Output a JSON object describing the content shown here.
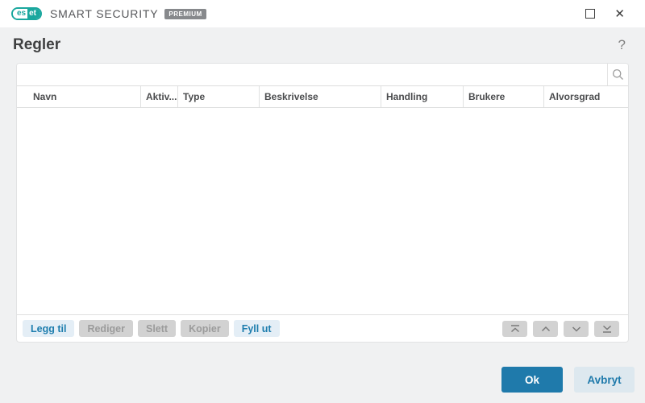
{
  "window": {
    "brand": {
      "logo_left": "es",
      "logo_right": "et",
      "name": "SMART SECURITY",
      "badge": "PREMIUM"
    },
    "controls": {
      "maximize_icon": "maximize-icon",
      "close_glyph": "✕"
    }
  },
  "page": {
    "title": "Regler",
    "help_glyph": "?"
  },
  "search": {
    "value": "",
    "placeholder": "",
    "icon": "search-icon"
  },
  "table": {
    "columns": [
      "Navn",
      "Aktiv...",
      "Type",
      "Beskrivelse",
      "Handling",
      "Brukere",
      "Alvorsgrad"
    ],
    "rows": []
  },
  "toolbar": {
    "buttons": [
      {
        "label": "Legg til",
        "enabled": true
      },
      {
        "label": "Rediger",
        "enabled": false
      },
      {
        "label": "Slett",
        "enabled": false
      },
      {
        "label": "Kopier",
        "enabled": false
      },
      {
        "label": "Fyll ut",
        "enabled": true
      }
    ],
    "move_buttons": [
      {
        "icon": "move-top-icon"
      },
      {
        "icon": "move-up-icon"
      },
      {
        "icon": "move-down-icon"
      },
      {
        "icon": "move-bottom-icon"
      }
    ]
  },
  "footer": {
    "ok_label": "Ok",
    "cancel_label": "Avbryt"
  },
  "colors": {
    "eset_teal": "#1aa79e",
    "primary_blue": "#1f7aab",
    "action_button_bg": "#e4eef6",
    "action_button_text": "#1d7dae",
    "disabled_button_bg": "#d2d2d2",
    "page_bg": "#f0f1f2"
  }
}
